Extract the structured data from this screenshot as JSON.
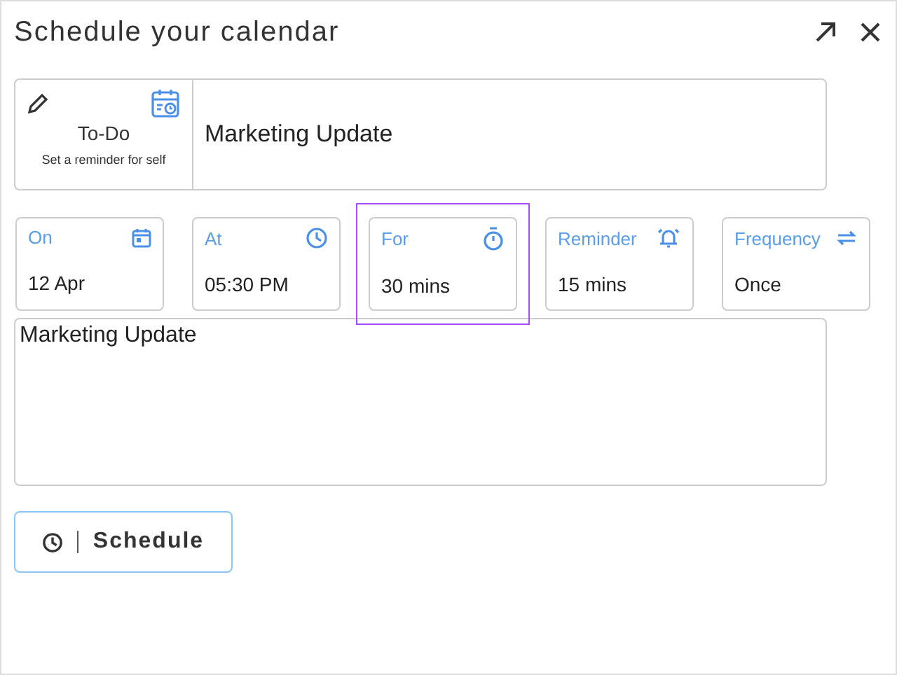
{
  "window": {
    "title": "Schedule your calendar"
  },
  "type_card": {
    "label": "To-Do",
    "caption": "Set a reminder for self"
  },
  "title_field": {
    "value": "Marketing Update"
  },
  "fields": [
    {
      "kind": "date",
      "label": "On",
      "value": "12 Apr",
      "selected": false
    },
    {
      "kind": "time",
      "label": "At",
      "value": "05:30 PM",
      "selected": false
    },
    {
      "kind": "duration",
      "label": "For",
      "value": "30 mins",
      "selected": true
    },
    {
      "kind": "reminder",
      "label": "Reminder",
      "value": "15 mins",
      "selected": false
    },
    {
      "kind": "frequency",
      "label": "Frequency",
      "value": "Once",
      "selected": false
    }
  ],
  "notes": {
    "value": "Marketing Update"
  },
  "schedule_button": {
    "label": "Schedule"
  }
}
